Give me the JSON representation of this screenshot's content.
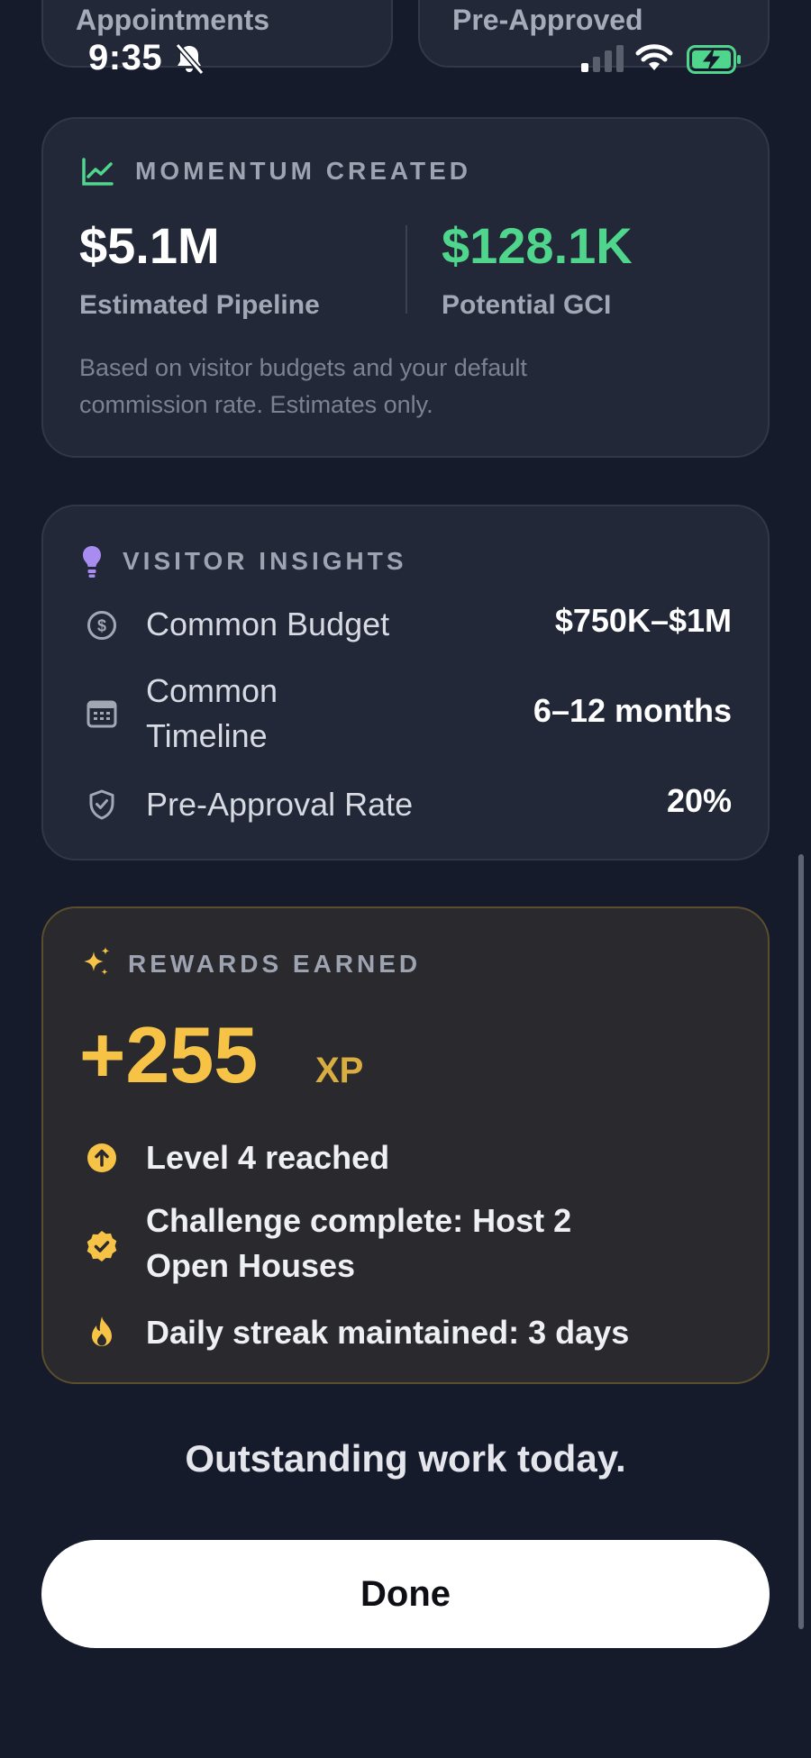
{
  "top_cards": {
    "left_label": "Appointments",
    "right_label": "Pre-Approved"
  },
  "status_bar": {
    "time": "9:35",
    "icons": [
      "bell-slash-icon",
      "cellular-signal-icon",
      "wifi-icon",
      "battery-charging-icon"
    ]
  },
  "momentum": {
    "title": "MOMENTUM CREATED",
    "icon": "trend-chart-icon",
    "pipeline_value": "$5.1M",
    "pipeline_label": "Estimated Pipeline",
    "gci_value": "$128.1K",
    "gci_label": "Potential GCI",
    "note": "Based on visitor budgets and your default commission rate. Estimates only.",
    "colors": {
      "gci": "#4fd58c",
      "icon": "#4fd58c"
    }
  },
  "insights": {
    "title": "VISITOR INSIGHTS",
    "icon": "lightbulb-icon",
    "rows": [
      {
        "icon": "dollar-circle-icon",
        "label": "Common Budget",
        "value": "$750K–$1M"
      },
      {
        "icon": "calendar-icon",
        "label": "Common Timeline",
        "value": "6–12 months"
      },
      {
        "icon": "shield-check-icon",
        "label": "Pre-Approval Rate",
        "value": "20%"
      }
    ],
    "colors": {
      "icon": "#a88cf0"
    }
  },
  "rewards": {
    "title": "REWARDS EARNED",
    "icon": "sparkles-icon",
    "xp_value": "+255",
    "xp_unit": "XP",
    "items": [
      {
        "icon": "arrow-up-circle-icon",
        "text": "Level 4 reached"
      },
      {
        "icon": "check-badge-icon",
        "text": "Challenge complete: Host 2 Open Houses"
      },
      {
        "icon": "flame-icon",
        "text": "Daily streak maintained: 3 days"
      }
    ],
    "colors": {
      "accent": "#f6c347"
    }
  },
  "footer": {
    "message": "Outstanding work today.",
    "done_label": "Done"
  }
}
